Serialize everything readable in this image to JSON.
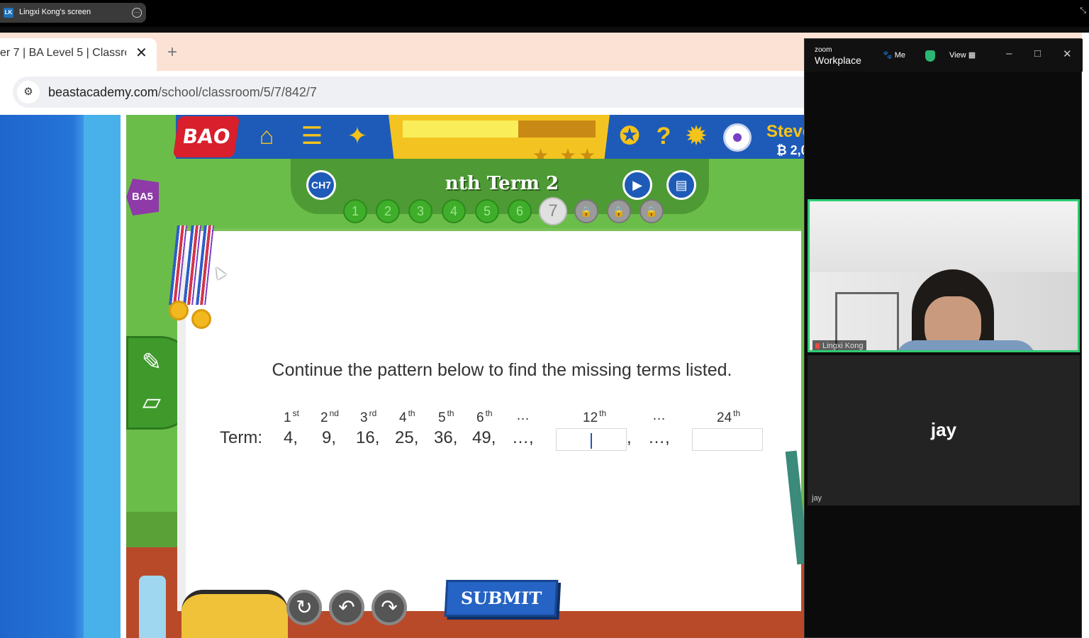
{
  "zoom_share": {
    "initials": "LK",
    "title": "Lingxi Kong's screen",
    "more_icon": "more-dots-icon"
  },
  "browser": {
    "tab_title": "er 7 | BA Level 5 | Classroo",
    "close": "✕",
    "new_tab": "+",
    "url_domain": "beastacademy.com",
    "url_path": "/school/classroom/5/7/842/7"
  },
  "game": {
    "logo": "BAO",
    "level_badge": "BA5",
    "progress": 0.6,
    "stars": "★ ★★",
    "user_name": "Steve",
    "coins": "₿ 2,0",
    "chapter": "CH7",
    "lesson_title": "nth Term 2",
    "levels": [
      "1",
      "2",
      "3",
      "4",
      "5",
      "6",
      "7",
      "",
      "",
      ""
    ],
    "current_level": "7",
    "prompt": "Continue the pattern below to find the missing terms listed.",
    "term_label": "Term:",
    "ordinals": [
      {
        "num": "1",
        "suf": "st"
      },
      {
        "num": "2",
        "suf": "nd"
      },
      {
        "num": "3",
        "suf": "rd"
      },
      {
        "num": "4",
        "suf": "th"
      },
      {
        "num": "5",
        "suf": "th"
      },
      {
        "num": "6",
        "suf": "th"
      },
      {
        "num": "…",
        "suf": ""
      },
      {
        "num": "12",
        "suf": "th"
      },
      {
        "num": "…",
        "suf": ""
      },
      {
        "num": "24",
        "suf": "th"
      }
    ],
    "terms": [
      "4,",
      "9,",
      "16,",
      "25,",
      "36,",
      "49,",
      "…,",
      ",",
      "…,"
    ],
    "submit": "SUBMIT"
  },
  "zoom_panel": {
    "brand_small": "zoom",
    "brand": "Workplace",
    "me": "Me",
    "view": "View",
    "participant_1": "Lingxi Kong",
    "participant_2_big": "jay",
    "participant_2_small": "jay"
  },
  "colors": {
    "accent": "#1e5bb8",
    "gold": "#f5c31a",
    "green": "#6bbd4a",
    "zoom_highlight": "#2ecc71"
  }
}
